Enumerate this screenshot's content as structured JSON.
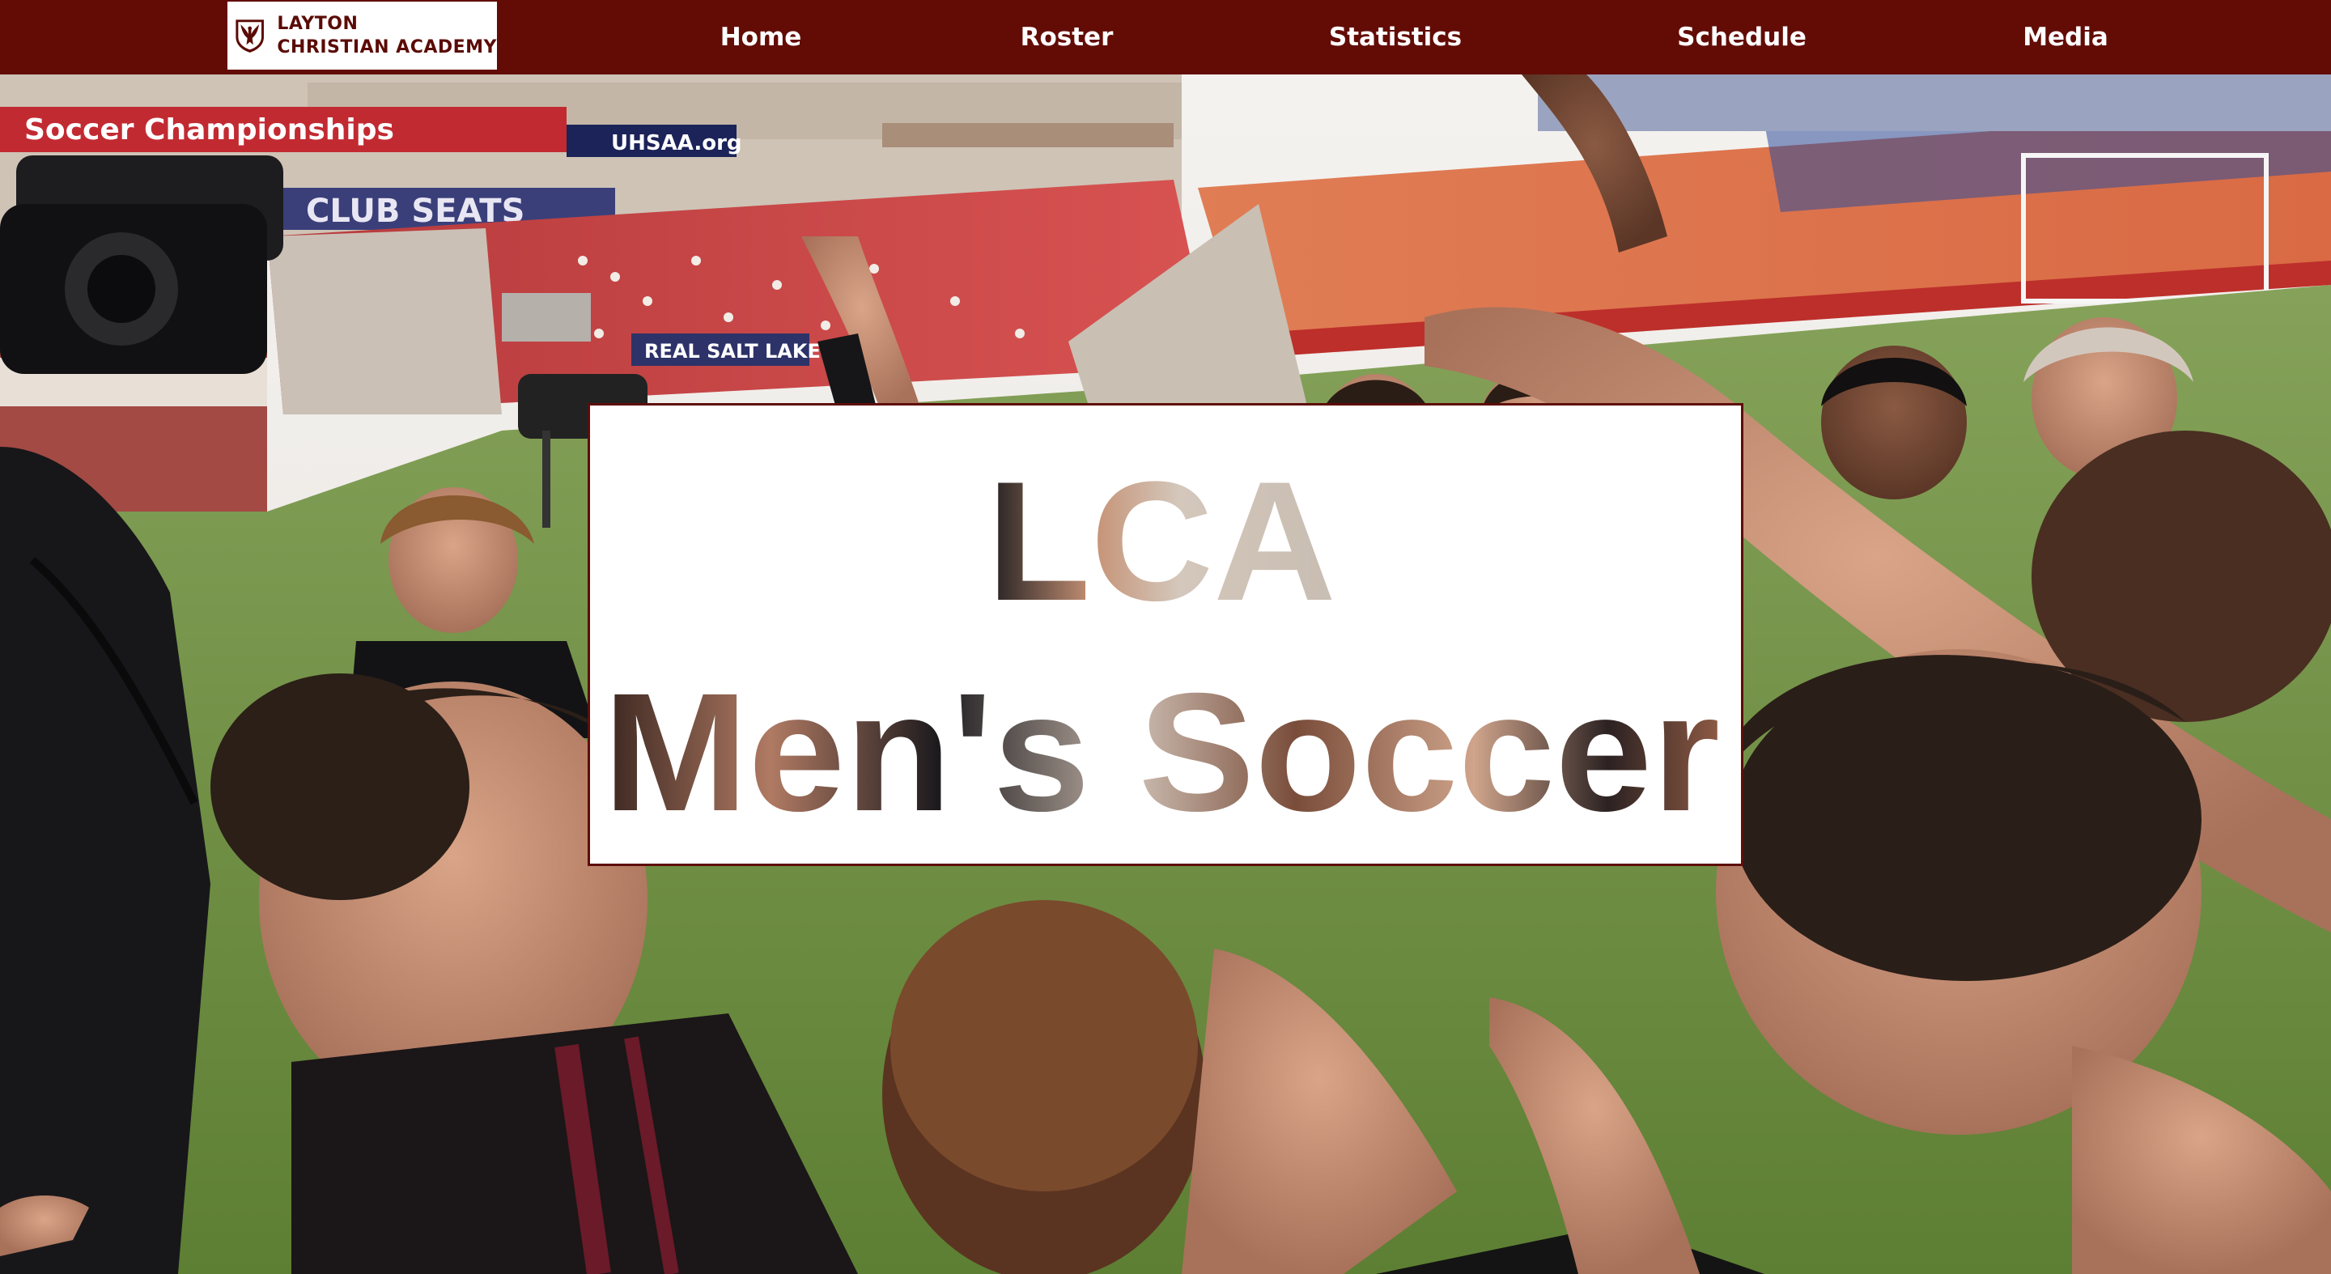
{
  "logo": {
    "line1": "LAYTON",
    "line2": "CHRISTIAN ACADEMY",
    "icon": "eagle-crest-icon"
  },
  "nav": {
    "items": [
      {
        "label": "Home"
      },
      {
        "label": "Roster"
      },
      {
        "label": "Statistics"
      },
      {
        "label": "Schedule"
      },
      {
        "label": "Media"
      }
    ]
  },
  "hero": {
    "title_line1": "LCA",
    "title_line2": "Men's Soccer",
    "stadium_banner": "Soccer Championships",
    "stadium_sponsor": "UHSAA.org",
    "club_seats_sign": "CLUB SEATS",
    "stand_sign": "REAL SALT LAKE"
  },
  "colors": {
    "brand_maroon": "#630c06",
    "card_border": "#5e0d08",
    "nav_text": "#ffffff"
  }
}
